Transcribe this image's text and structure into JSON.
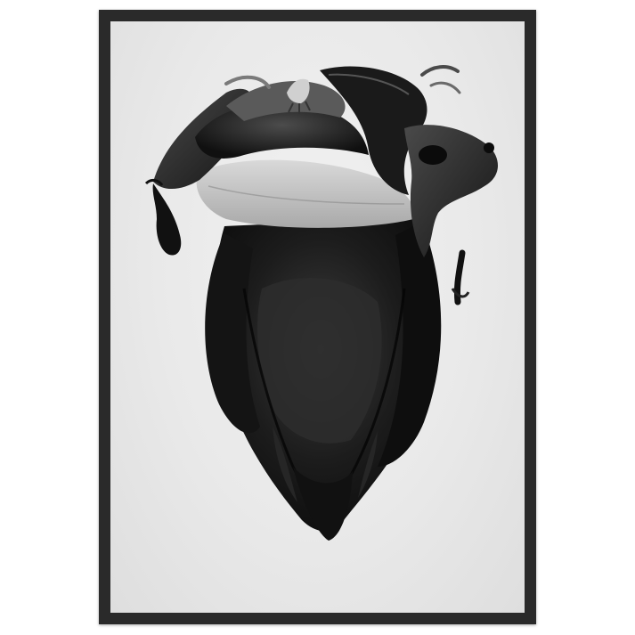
{
  "artwork": {
    "style": "black-and-white",
    "subject_icon": "banana-flower-icon",
    "colors": {
      "frame": "#2a2a2a",
      "paper": "#ececec",
      "ink_dark": "#111111",
      "ink_mid": "#3c3c3c",
      "ink_light": "#bdbdbd"
    }
  }
}
